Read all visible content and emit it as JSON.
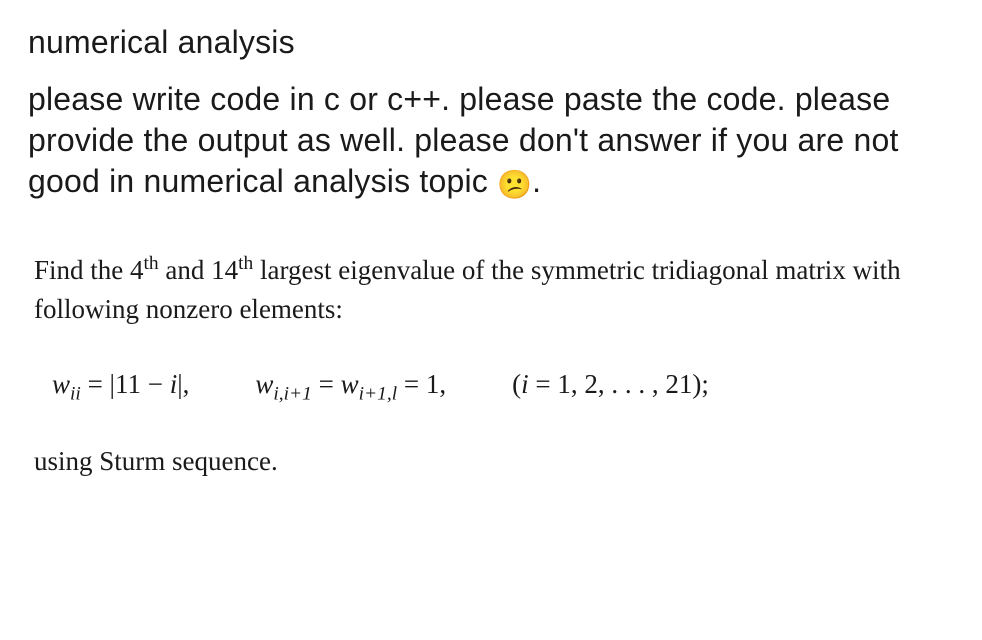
{
  "title": "numerical analysis",
  "instructions_part1": "please write code in c or c++. please paste the code. please provide the output as well. please don't answer if you are not good in numerical analysis topic ",
  "emoji": "😕",
  "instructions_period": ".",
  "problem": {
    "line_pre": "Find the ",
    "ord4_num": "4",
    "ord4_suf": "th",
    "line_mid1": " and ",
    "ord14_num": "14",
    "ord14_suf": "th",
    "line_post": " largest eigenvalue of the symmetric tridiagonal matrix with following nonzero elements:",
    "eq1_w": "w",
    "eq1_sub": "ii",
    "eq1_eq": " = |11 − ",
    "eq1_i": "i",
    "eq1_end": "|,",
    "eq2_w1": "w",
    "eq2_sub1": "i,i+1",
    "eq2_eq1": " = ",
    "eq2_w2": "w",
    "eq2_sub2": "i+1,l",
    "eq2_eq2": " = 1,",
    "eq3_open": "(",
    "eq3_i": "i",
    "eq3_rest": " = 1, 2, . . . , 21);",
    "closing": "using Sturm sequence."
  }
}
